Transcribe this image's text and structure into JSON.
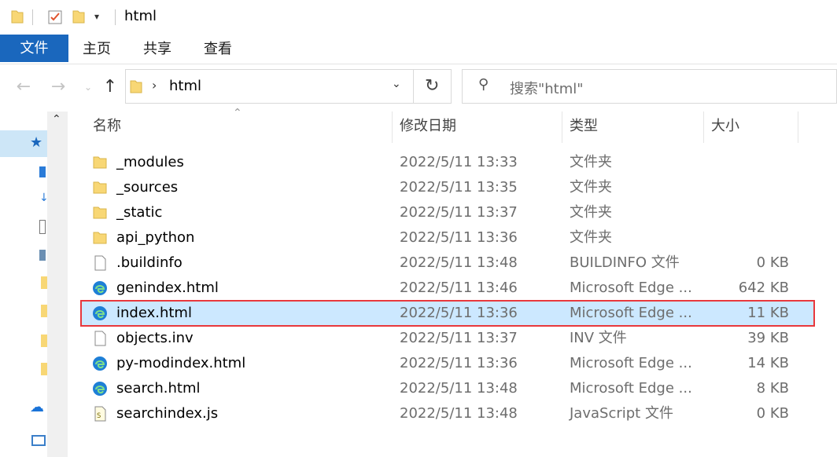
{
  "window": {
    "title": "html"
  },
  "ribbon": {
    "tabs": [
      "文件",
      "主页",
      "共享",
      "查看"
    ]
  },
  "address": {
    "crumb": "html"
  },
  "search": {
    "placeholder": "搜索\"html\""
  },
  "columns": {
    "name": "名称",
    "date": "修改日期",
    "type": "类型",
    "size": "大小"
  },
  "files": [
    {
      "name": "_modules",
      "date": "2022/5/11 13:33",
      "type": "文件夹",
      "size": "",
      "icon": "folder-icon"
    },
    {
      "name": "_sources",
      "date": "2022/5/11 13:35",
      "type": "文件夹",
      "size": "",
      "icon": "folder-icon"
    },
    {
      "name": "_static",
      "date": "2022/5/11 13:37",
      "type": "文件夹",
      "size": "",
      "icon": "folder-icon"
    },
    {
      "name": "api_python",
      "date": "2022/5/11 13:36",
      "type": "文件夹",
      "size": "",
      "icon": "folder-icon"
    },
    {
      "name": ".buildinfo",
      "date": "2022/5/11 13:48",
      "type": "BUILDINFO 文件",
      "size": "0 KB",
      "icon": "file-icon"
    },
    {
      "name": "genindex.html",
      "date": "2022/5/11 13:46",
      "type": "Microsoft Edge ...",
      "size": "642 KB",
      "icon": "edge-icon"
    },
    {
      "name": "index.html",
      "date": "2022/5/11 13:36",
      "type": "Microsoft Edge ...",
      "size": "11 KB",
      "icon": "edge-icon",
      "selected": true
    },
    {
      "name": "objects.inv",
      "date": "2022/5/11 13:37",
      "type": "INV 文件",
      "size": "39 KB",
      "icon": "file-icon"
    },
    {
      "name": "py-modindex.html",
      "date": "2022/5/11 13:36",
      "type": "Microsoft Edge ...",
      "size": "14 KB",
      "icon": "edge-icon"
    },
    {
      "name": "search.html",
      "date": "2022/5/11 13:48",
      "type": "Microsoft Edge ...",
      "size": "8 KB",
      "icon": "edge-icon"
    },
    {
      "name": "searchindex.js",
      "date": "2022/5/11 13:48",
      "type": "JavaScript 文件",
      "size": "0 KB",
      "icon": "js-file-icon"
    }
  ],
  "colors": {
    "accent": "#1a67bd",
    "selection": "#cce8ff",
    "highlight": "#e8383c",
    "folder": "#f8d775"
  }
}
